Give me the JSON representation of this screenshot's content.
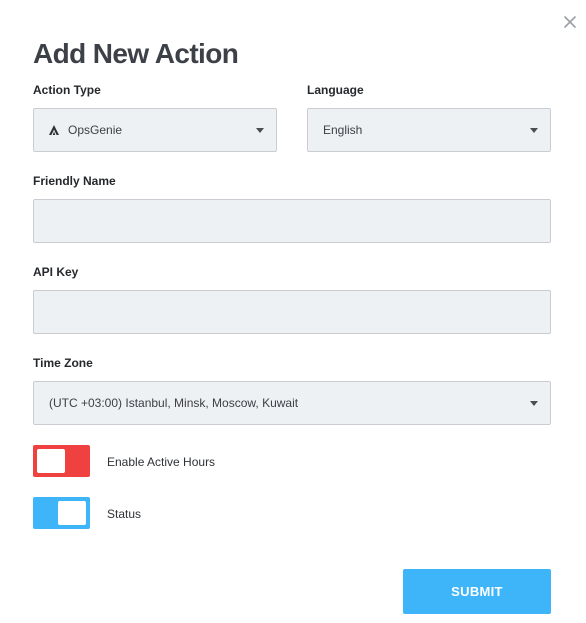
{
  "dialog": {
    "title": "Add New Action",
    "close_icon": "close-icon"
  },
  "form": {
    "action_type": {
      "label": "Action Type",
      "value": "OpsGenie",
      "icon": "opsgenie-logo-icon"
    },
    "language": {
      "label": "Language",
      "value": "English"
    },
    "friendly_name": {
      "label": "Friendly Name",
      "value": "",
      "placeholder": ""
    },
    "api_key": {
      "label": "API Key",
      "value": "",
      "placeholder": ""
    },
    "time_zone": {
      "label": "Time Zone",
      "value": "(UTC +03:00) Istanbul, Minsk, Moscow, Kuwait"
    },
    "enable_active_hours": {
      "label": "Enable Active Hours",
      "on": false,
      "color": "#f04141"
    },
    "status": {
      "label": "Status",
      "on": true,
      "color": "#3eb4f9"
    }
  },
  "actions": {
    "submit_label": "SUBMIT"
  },
  "colors": {
    "field_bg": "#eef1f3",
    "field_border": "#c9cdd1",
    "accent": "#3eb4f9",
    "danger": "#f04141"
  }
}
